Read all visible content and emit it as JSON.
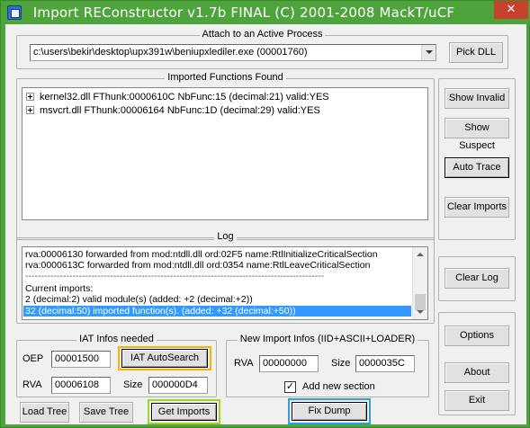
{
  "window": {
    "title": "Import REConstructor v1.7b FINAL (C) 2001-2008 MackT/uCF",
    "close_glyph": "✕"
  },
  "attach": {
    "group_title": "Attach to an Active Process",
    "process_value": "c:\\users\\bekir\\desktop\\upx391w\\beniupxlediler.exe (00001760)",
    "pick_dll_label": "Pick DLL"
  },
  "imports": {
    "group_title": "Imported Functions Found",
    "tree_items": [
      "kernel32.dll FThunk:0000610C NbFunc:15 (decimal:21) valid:YES",
      "msvcrt.dll FThunk:00006164 NbFunc:1D (decimal:29) valid:YES"
    ]
  },
  "side_buttons": {
    "show_invalid": "Show Invalid",
    "show_suspect": "Show Suspect",
    "auto_trace": "Auto Trace",
    "clear_imports": "Clear Imports"
  },
  "log": {
    "group_title": "Log",
    "lines": [
      "rva:00006130 forwarded from mod:ntdll.dll ord:02F5 name:RtlInitializeCriticalSection",
      "rva:0000613C forwarded from mod:ntdll.dll ord:0354 name:RtlLeaveCriticalSection",
      "-----------------------------------------------------------------------------------------------",
      "Current imports:",
      "2 (decimal:2) valid module(s) (added: +2 (decimal:+2))",
      "32 (decimal:50) imported function(s). (added: +32 (decimal:+50))"
    ],
    "clear_log_label": "Clear Log"
  },
  "iat": {
    "group_title": "IAT Infos needed",
    "oep_label": "OEP",
    "oep_value": "00001500",
    "autosearch_label": "IAT AutoSearch",
    "rva_label": "RVA",
    "rva_value": "00006108",
    "size_label": "Size",
    "size_value": "000000D4"
  },
  "new_import": {
    "group_title": "New Import Infos (IID+ASCII+LOADER)",
    "rva_label": "RVA",
    "rva_value": "00000000",
    "size_label": "Size",
    "size_value": "0000035C",
    "add_section_label": "Add new section",
    "add_section_checked": "✓"
  },
  "bottom_buttons": {
    "load_tree": "Load Tree",
    "save_tree": "Save Tree",
    "get_imports": "Get Imports",
    "fix_dump": "Fix Dump"
  },
  "right_buttons": {
    "options": "Options",
    "about": "About",
    "exit": "Exit"
  },
  "highlights": {
    "iat_autosearch_color": "#f5b400",
    "get_imports_color": "#a3d422",
    "fix_dump_color": "#2aa0e0"
  },
  "colors": {
    "title_bar": "#4ea33c",
    "close_button": "#c7412f",
    "selection": "#3399ff"
  }
}
